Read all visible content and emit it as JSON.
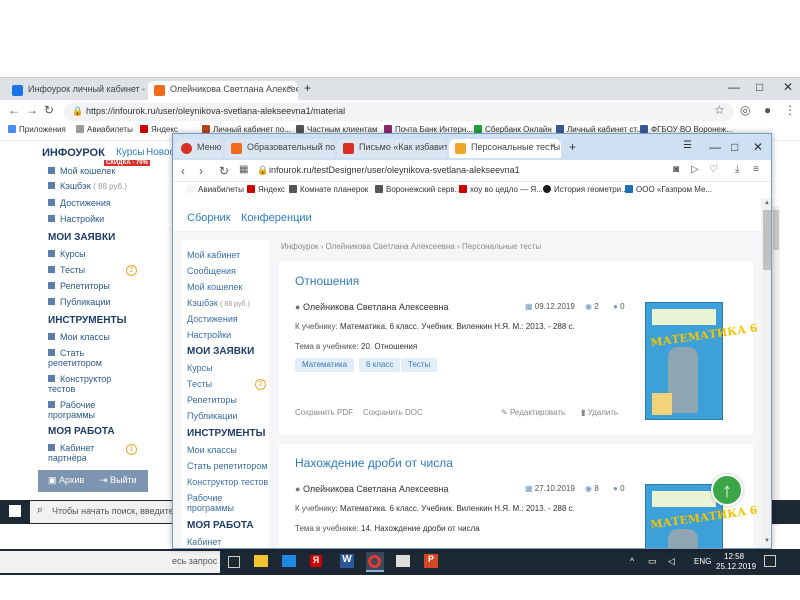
{
  "back_window": {
    "tabs": [
      {
        "label": "Инфоурок личный кабинет - Я...",
        "favicon_color": "#1a73e8"
      },
      {
        "label": "Олейникова Светлана Алексеевна",
        "favicon_color": "#f26b1d"
      }
    ],
    "new_tab": "+",
    "controls": {
      "minimize": "—",
      "maximize": "□",
      "close": "✕"
    },
    "url": "https://infourok.ru/user/oleynikova-svetlana-alekseevna1/material",
    "bookmarks": [
      "Приложения",
      "Авиабилеты",
      "Яндекс",
      "Личный кабинет по...",
      "Частным клиентам",
      "Почта Банк Интерн...",
      "Сбербанк Онлайн",
      "Личный кабинет ст...",
      "ФГБОУ ВО Воронеж..."
    ],
    "site": {
      "logo": "ИНФОУРОК",
      "logo_badge": "СКИДКА - 70%",
      "top_nav": [
        "Курсы",
        "Новос"
      ]
    },
    "sidebar": {
      "items_a": [
        {
          "label": "Мой кошелек"
        },
        {
          "label": "Кэшбэк",
          "extra": "( 88 руб.)"
        },
        {
          "label": "Достижения"
        },
        {
          "label": "Настройки"
        }
      ],
      "head1": "МОИ ЗАЯВКИ",
      "items_b": [
        {
          "label": "Курсы"
        },
        {
          "label": "Тесты",
          "badge": "2"
        },
        {
          "label": "Репетиторы"
        },
        {
          "label": "Публикации"
        }
      ],
      "head2": "ИНСТРУМЕНТЫ",
      "items_c": [
        {
          "label": "Мои классы"
        },
        {
          "label": "Стать репетитором"
        },
        {
          "label": "Конструктор тестов"
        },
        {
          "label": "Рабочие программы"
        }
      ],
      "head3": "МОЯ РАБОТА",
      "items_d": [
        {
          "label": "Кабинет партнёра",
          "badge": "1"
        }
      ],
      "archive": "Архив",
      "logout": "Выйти"
    }
  },
  "taskbar": {
    "search_placeholder": "Чтобы начать поиск, введите",
    "search_tail": "есь запрос",
    "lang": "ENG",
    "time": "12:58",
    "date": "25.12.2019"
  },
  "front_window": {
    "tabs": [
      {
        "label": "Меню",
        "favicon_color": "#d93025"
      },
      {
        "label": "Образовательный порта",
        "favicon_color": "#f26b1d"
      },
      {
        "label": "Письмо «Как избавиться",
        "favicon_color": "#d93025"
      },
      {
        "label": "Персональные тесты - О",
        "favicon_color": "#f0a52d"
      }
    ],
    "new_tab": "+",
    "controls": {
      "menu": "☰",
      "minimize": "—",
      "maximize": "□",
      "close": "✕"
    },
    "url": "infourok.ru/testDesigner/user/oleynikova-svetlana-alekseevna1",
    "bookmarks": [
      "Авиабилеты",
      "Яндекс",
      "Комнате планерок",
      "Воронежский серв...",
      "хоу во цедло — Я...",
      "История геометри...",
      "ООО «Газпром Ме..."
    ],
    "site_nav": [
      "Сборник",
      "Конференции"
    ],
    "breadcrumb": "Инфоурок › Олейникова Светлана Алексеевна › Персональные тесты",
    "sidebar": {
      "items_a": [
        "Мой кабинет",
        "Сообщения",
        "Мой кошелек",
        "Кэшбэк",
        "Достижения",
        "Настройки"
      ],
      "cashback_extra": "( 88 руб.)",
      "head1": "МОИ ЗАЯВКИ",
      "items_b": [
        "Курсы",
        "Тесты",
        "Репетиторы",
        "Публикации"
      ],
      "tests_badge": "2",
      "head2": "ИНСТРУМЕНТЫ",
      "items_c": [
        "Мои классы",
        "Стать репетитором",
        "Конструктор тестов",
        "Рабочие программы"
      ],
      "head3": "МОЯ РАБОТА",
      "items_d": [
        "Кабинет"
      ]
    },
    "cards": [
      {
        "title": "Отношения",
        "author": "Олейникова Светлана Алексеевна",
        "date": "09.12.2019",
        "views": "2",
        "comments": "0",
        "textbook_label": "К учебнику:",
        "textbook": "Математика. 6 класс. Учебник. Виленкин Н.Я. М.: 2013. - 288 с.",
        "topic_label": "Тема в учебнике:",
        "topic": "20. Отношения",
        "tags": [
          "Математика",
          "6 класс",
          "Тесты"
        ],
        "save_pdf": "Сохранить PDF",
        "save_doc": "Сохранить DOC",
        "edit": "Редактировать",
        "delete": "Удалить",
        "book_title": "МАТЕМАТИКА",
        "book_grade": "6"
      },
      {
        "title": "Нахождение дроби от числа",
        "author": "Олейникова Светлана Алексеевна",
        "date": "27.10.2019",
        "views": "8",
        "comments": "0",
        "textbook_label": "К учебнику:",
        "textbook": "Математика. 6 класс. Учебник. Виленкин Н.Я. М.: 2013. - 288 с.",
        "topic_label": "Тема в учебнике:",
        "topic": "14. Нахождение дроби от числа",
        "book_title": "МАТЕМАТИКА",
        "book_grade": "6"
      }
    ],
    "scroll_top_icon": "↑"
  },
  "colors": {
    "accent": "#2e7cc0",
    "badge": "#f0a52d",
    "up_button": "#3aa648"
  }
}
